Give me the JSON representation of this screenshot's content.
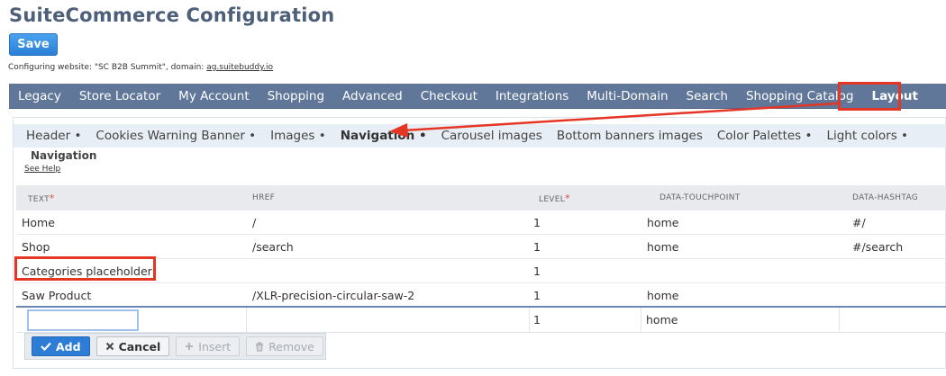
{
  "header": {
    "title": "SuiteCommerce Configuration",
    "save_label": "Save",
    "config_prefix": "Configuring website: \"SC B2B Summit\", domain: ",
    "config_domain": "ag.suitebuddy.io"
  },
  "topnav": {
    "tabs": [
      "Legacy",
      "Store Locator",
      "My Account",
      "Shopping",
      "Advanced",
      "Checkout",
      "Integrations",
      "Multi-Domain",
      "Search",
      "Shopping Catalog",
      "Layout"
    ],
    "active": "Layout"
  },
  "subnav": {
    "tabs": [
      "Header •",
      "Cookies Warning Banner •",
      "Images •",
      "Navigation •",
      "Carousel images",
      "Bottom banners images",
      "Color Palettes •",
      "Light colors •"
    ],
    "active": "Navigation •"
  },
  "section": {
    "title": "Navigation",
    "help_link": "See Help"
  },
  "grid": {
    "columns": [
      "TEXT",
      "HREF",
      "LEVEL",
      "DATA-TOUCHPOINT",
      "DATA-HASHTAG"
    ],
    "required_marker": "*",
    "rows": [
      [
        "Home",
        "/",
        "1",
        "home",
        "#/"
      ],
      [
        "Shop",
        "/search",
        "1",
        "home",
        "#/search"
      ],
      [
        "Categories placeholder",
        "",
        "1",
        "",
        ""
      ],
      [
        "Saw Product",
        "/XLR-precision-circular-saw-2",
        "1",
        "home",
        ""
      ]
    ],
    "edit_row": {
      "text_value": "",
      "level": "1",
      "touchpoint": "home"
    }
  },
  "buttons": {
    "add": "Add",
    "cancel": "Cancel",
    "insert": "Insert",
    "remove": "Remove"
  },
  "annotations": {
    "color": "#e53524"
  }
}
